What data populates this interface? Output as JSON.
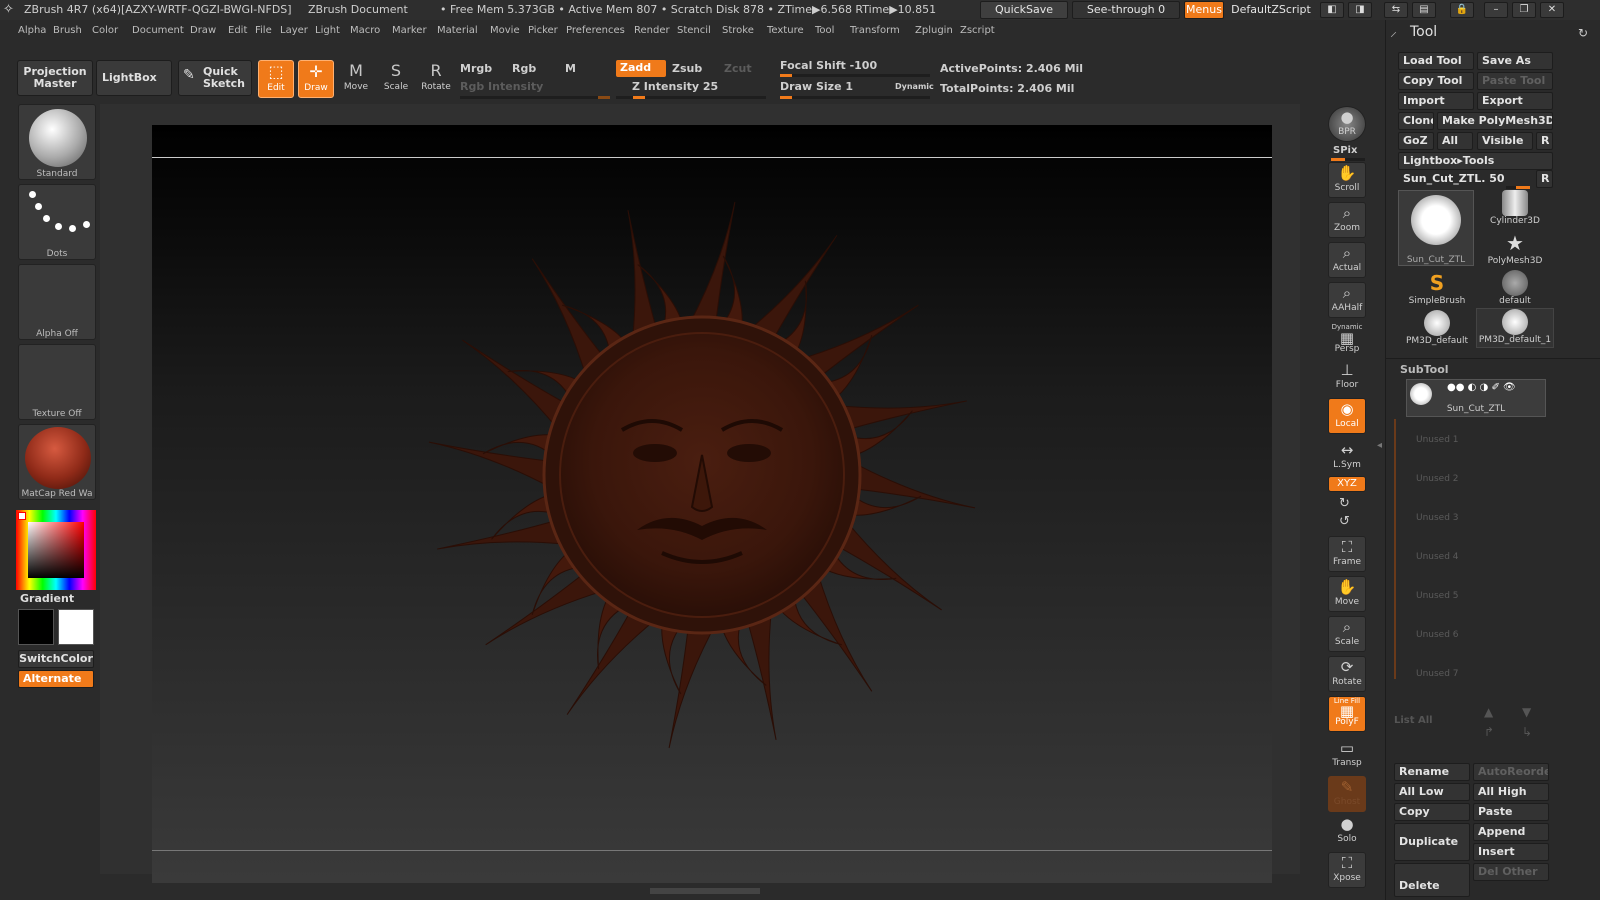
{
  "titlebar": {
    "app": "ZBrush 4R7 (x64)[AZXY-WRTF-QGZI-BWGI-NFDS]",
    "doc": "ZBrush Document",
    "stats": "• Free Mem 5.373GB • Active Mem 807 • Scratch Disk 878 • ZTime▶6.568 RTime▶10.851",
    "quicksave": "QuickSave",
    "seethrough": "See-through  0",
    "menus": "Menus",
    "script": "DefaultZScript"
  },
  "menubar": [
    "Alpha",
    "Brush",
    "Color",
    "Document",
    "Draw",
    "Edit",
    "File",
    "Layer",
    "Light",
    "Macro",
    "Marker",
    "Material",
    "Movie",
    "Picker",
    "Preferences",
    "Render",
    "Stencil",
    "Stroke",
    "Texture",
    "Tool",
    "Transform",
    "Zplugin",
    "Zscript"
  ],
  "topshelf": {
    "projection": "Projection Master",
    "lightbox": "LightBox",
    "quicksketch": "Quick Sketch",
    "edit": "Edit",
    "draw": "Draw",
    "move": "Move",
    "scale": "Scale",
    "rotate": "Rotate",
    "mrgb": "Mrgb",
    "rgb": "Rgb",
    "m": "M",
    "rgb_intensity": "Rgb  Intensity",
    "zadd": "Zadd",
    "zsub": "Zsub",
    "zcut": "Zcut",
    "z_intensity": "Z Intensity 25",
    "z_intensity_value": 0.25,
    "focal_shift": "Focal Shift -100",
    "draw_size": "Draw Size 1",
    "dynamic": "Dynamic",
    "active_points": "ActivePoints: 2.406  Mil",
    "total_points": "TotalPoints: 2.406  Mil"
  },
  "leftshelf": {
    "brush": "Standard",
    "stroke": "Dots",
    "alpha": "Alpha  Off",
    "texture": "Texture  Off",
    "material": "MatCap Red Wa",
    "gradient": "Gradient",
    "switchcolor": "SwitchColor",
    "alternate": "Alternate"
  },
  "rightshelf": {
    "bpr": "BPR",
    "spix": "SPix",
    "scroll": "Scroll",
    "zoom": "Zoom",
    "actual": "Actual",
    "aahalf": "AAHalf",
    "dynamic": "Dynamic",
    "persp": "Persp",
    "floor": "Floor",
    "local": "Local",
    "lsym": "L.Sym",
    "xyz": "XYZ",
    "frame": "Frame",
    "move": "Move",
    "scale": "Scale",
    "rotate": "Rotate",
    "linefill": "Line Fill",
    "polyf": "PolyF",
    "transp": "Transp",
    "ghost": "Ghost",
    "solo": "Solo",
    "xpose": "Xpose"
  },
  "tool": {
    "title": "Tool",
    "load_tool": "Load Tool",
    "save_as": "Save As",
    "copy_tool": "Copy Tool",
    "paste_tool": "Paste Tool",
    "import": "Import",
    "export": "Export",
    "clone": "Clone",
    "make_polymesh": "Make PolyMesh3D",
    "goz": "GoZ",
    "all": "All",
    "visible": "Visible",
    "r": "R",
    "lightbox_tools": "Lightbox▸Tools",
    "current_tool": "Sun_Cut_ZTL. 50",
    "items": [
      "Sun_Cut_ZTL",
      "Cylinder3D",
      "PolyMesh3D",
      "SimpleBrush",
      "default",
      "PM3D_default",
      "PM3D_default_1"
    ]
  },
  "subtool": {
    "title": "SubTool",
    "active": "Sun_Cut_ZTL",
    "unused": [
      "Unused  1",
      "Unused  2",
      "Unused  3",
      "Unused  4",
      "Unused  5",
      "Unused  6",
      "Unused  7"
    ],
    "list_all": "List  All",
    "rename": "Rename",
    "autoreorder": "AutoReorder",
    "all_low": "All  Low",
    "all_high": "All  High",
    "copy": "Copy",
    "paste": "Paste",
    "duplicate": "Duplicate",
    "append": "Append",
    "insert": "Insert",
    "delete": "Delete",
    "del_other": "Del  Other"
  }
}
